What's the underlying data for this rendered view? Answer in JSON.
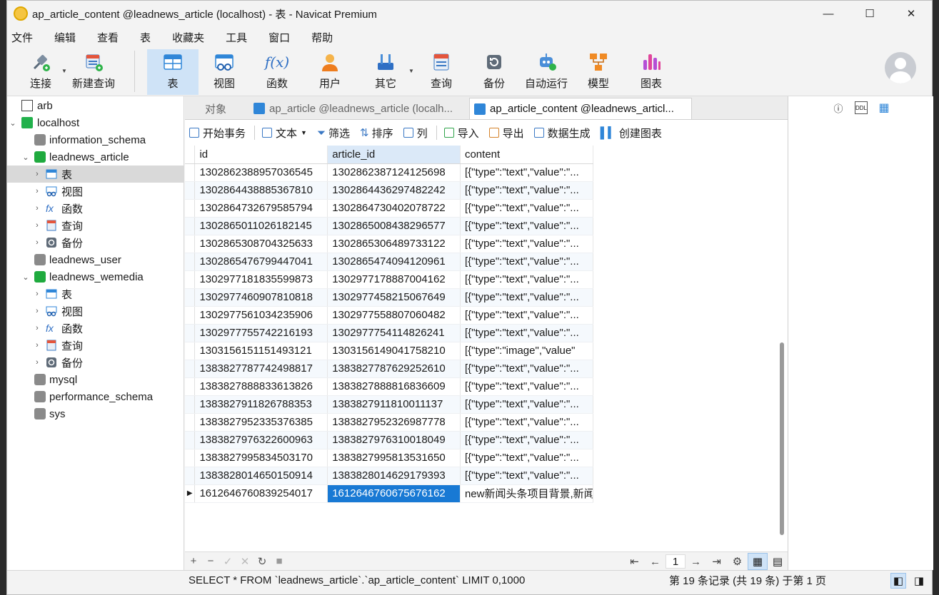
{
  "window": {
    "title": "ap_article_content @leadnews_article (localhost) - 表 - Navicat Premium",
    "minimize": "—",
    "maximize": "☐",
    "close": "✕"
  },
  "menu": [
    "文件",
    "编辑",
    "查看",
    "表",
    "收藏夹",
    "工具",
    "窗口",
    "帮助"
  ],
  "toolbar": {
    "connect": "连接",
    "new_query": "新建查询",
    "table": "表",
    "view": "视图",
    "function": "函数",
    "user": "用户",
    "other": "其它",
    "query": "查询",
    "backup": "备份",
    "automation": "自动运行",
    "model": "模型",
    "chart": "图表"
  },
  "sidebar": {
    "items": [
      {
        "label": "arb"
      },
      {
        "label": "localhost"
      },
      {
        "label": "information_schema"
      },
      {
        "label": "leadnews_article"
      },
      {
        "label": "表"
      },
      {
        "label": "视图"
      },
      {
        "label": "函数"
      },
      {
        "label": "查询"
      },
      {
        "label": "备份"
      },
      {
        "label": "leadnews_user"
      },
      {
        "label": "leadnews_wemedia"
      },
      {
        "label": "表"
      },
      {
        "label": "视图"
      },
      {
        "label": "函数"
      },
      {
        "label": "查询"
      },
      {
        "label": "备份"
      },
      {
        "label": "mysql"
      },
      {
        "label": "performance_schema"
      },
      {
        "label": "sys"
      }
    ]
  },
  "tabs": {
    "objects": "对象",
    "tab1": "ap_article @leadnews_article (localh...",
    "tab2": "ap_article_content @leadnews_articl..."
  },
  "subtoolbar": {
    "begin_tx": "开始事务",
    "text": "文本",
    "filter": "筛选",
    "sort": "排序",
    "columns": "列",
    "import": "导入",
    "export": "导出",
    "data_gen": "数据生成",
    "create_chart": "创建图表"
  },
  "grid": {
    "columns": [
      "id",
      "article_id",
      "content"
    ],
    "rows": [
      [
        "1302862388957036545",
        "1302862387124125698",
        "[{\"type\":\"text\",\"value\":\"..."
      ],
      [
        "1302864438885367810",
        "1302864436297482242",
        "[{\"type\":\"text\",\"value\":\"..."
      ],
      [
        "1302864732679585794",
        "1302864730402078722",
        "[{\"type\":\"text\",\"value\":\"..."
      ],
      [
        "1302865011026182145",
        "1302865008438296577",
        "[{\"type\":\"text\",\"value\":\"..."
      ],
      [
        "1302865308704325633",
        "1302865306489733122",
        "[{\"type\":\"text\",\"value\":\"..."
      ],
      [
        "1302865476799447041",
        "1302865474094120961",
        "[{\"type\":\"text\",\"value\":\"..."
      ],
      [
        "1302977181835599873",
        "1302977178887004162",
        "[{\"type\":\"text\",\"value\":\"..."
      ],
      [
        "1302977460907810818",
        "1302977458215067649",
        "[{\"type\":\"text\",\"value\":\"..."
      ],
      [
        "1302977561034235906",
        "1302977558807060482",
        "[{\"type\":\"text\",\"value\":\"..."
      ],
      [
        "1302977755742216193",
        "1302977754114826241",
        "[{\"type\":\"text\",\"value\":\"..."
      ],
      [
        "1303156151151493121",
        "1303156149041758210",
        "[{\"type\":\"image\",\"value\""
      ],
      [
        "1383827787742498817",
        "1383827787629252610",
        "[{\"type\":\"text\",\"value\":\"..."
      ],
      [
        "1383827888833613826",
        "1383827888816836609",
        "[{\"type\":\"text\",\"value\":\"..."
      ],
      [
        "1383827911826788353",
        "1383827911810011137",
        "[{\"type\":\"text\",\"value\":\"..."
      ],
      [
        "1383827952335376385",
        "1383827952326987778",
        "[{\"type\":\"text\",\"value\":\"..."
      ],
      [
        "1383827976322600963",
        "1383827976310018049",
        "[{\"type\":\"text\",\"value\":\"..."
      ],
      [
        "1383827995834503170",
        "1383827995813531650",
        "[{\"type\":\"text\",\"value\":\"..."
      ],
      [
        "1383828014650150914",
        "1383828014629179393",
        "[{\"type\":\"text\",\"value\":\"..."
      ],
      [
        "1612646760839254017",
        "1612646760675676162",
        "new新闻头条项目背景,新闻"
      ]
    ]
  },
  "pager": {
    "page": "1"
  },
  "status": {
    "sql": "SELECT * FROM `leadnews_article`.`ap_article_content` LIMIT 0,1000",
    "records": "第 19 条记录 (共 19 条) 于第 1 页"
  },
  "colors": {
    "accent": "#1879d4",
    "selected_tab": "#cfe3f7"
  }
}
